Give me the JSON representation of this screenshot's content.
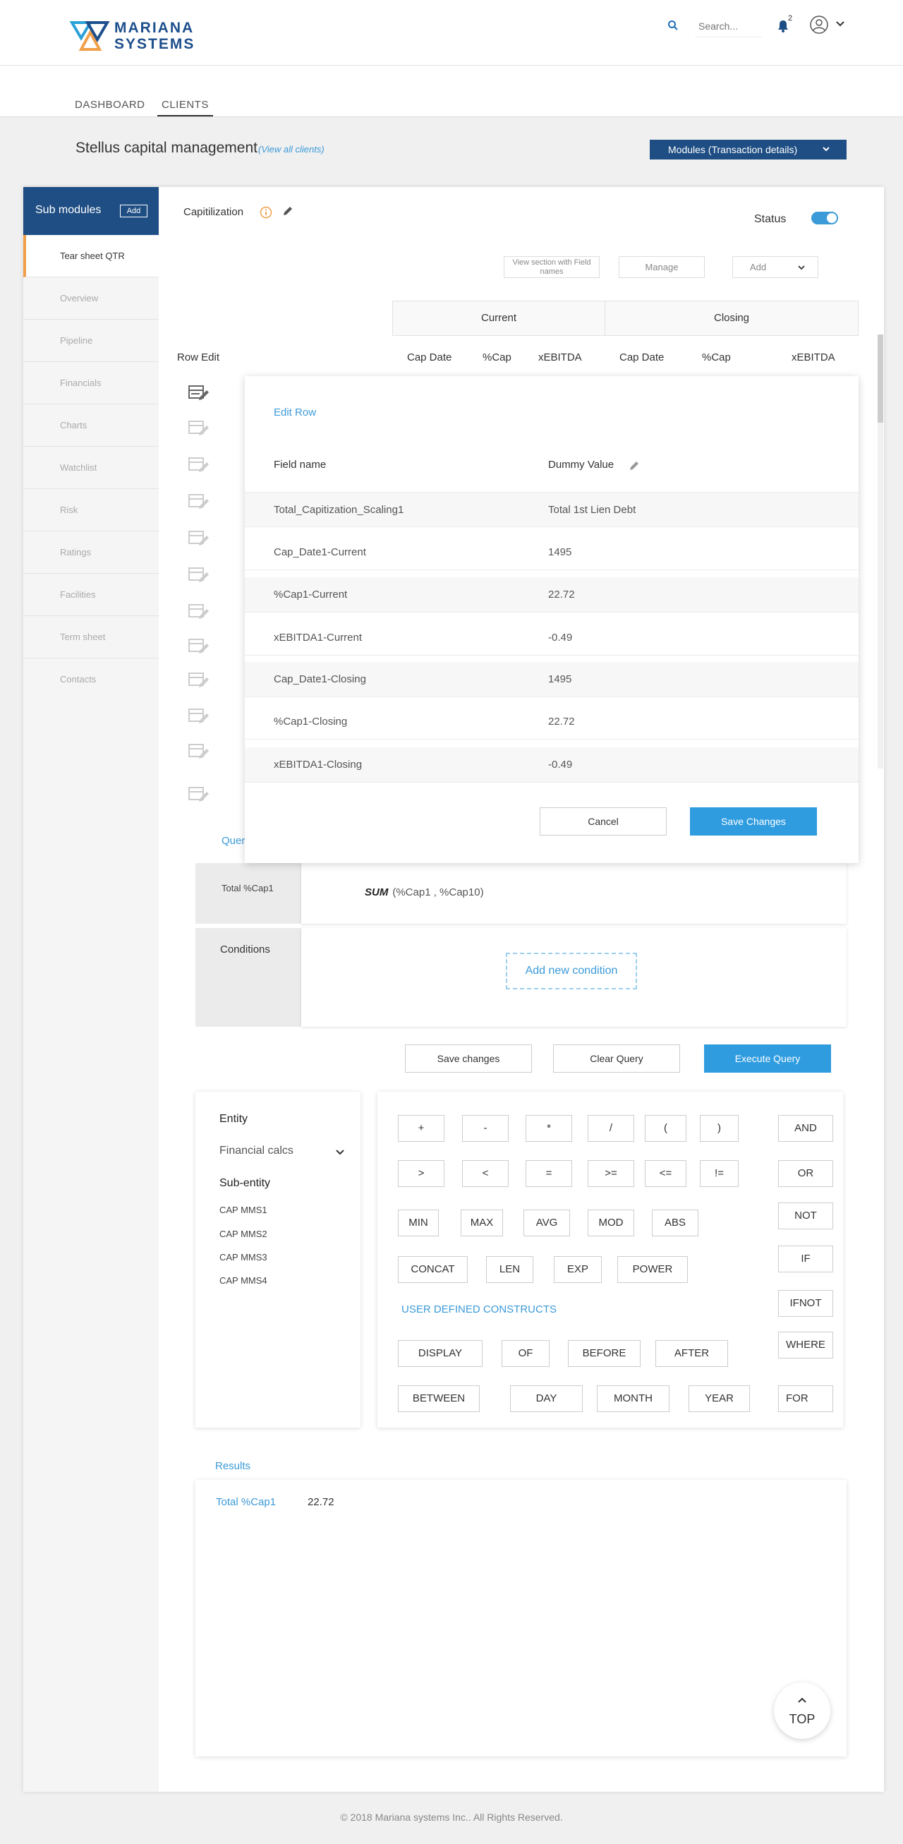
{
  "header": {
    "logo_line1": "MARIANA",
    "logo_line2": "SYSTEMS",
    "search_placeholder": "Search...",
    "notification_count": "2"
  },
  "nav": {
    "tabs": [
      {
        "label": "DASHBOARD"
      },
      {
        "label": "CLIENTS"
      }
    ],
    "active_index": 1
  },
  "page": {
    "title": "Stellus capital management",
    "view_all": "(View all clients)",
    "modules_button": "Modules  (Transaction details)"
  },
  "sidebar": {
    "title": "Sub modules",
    "add_label": "Add",
    "items": [
      {
        "label": "Tear sheet QTR"
      },
      {
        "label": "Overview"
      },
      {
        "label": "Pipeline"
      },
      {
        "label": "Financials"
      },
      {
        "label": "Charts"
      },
      {
        "label": "Watchlist"
      },
      {
        "label": "Risk"
      },
      {
        "label": "Ratings"
      },
      {
        "label": "Facilities"
      },
      {
        "label": "Term sheet"
      },
      {
        "label": "Contacts"
      }
    ]
  },
  "section": {
    "title": "Capitilization",
    "status_label": "Status",
    "status_on": true,
    "view_fields_btn": "View section with Field names",
    "manage_btn": "Manage",
    "add_btn": "Add",
    "group_current": "Current",
    "group_closing": "Closing",
    "row_edit": "Row Edit",
    "columns": [
      "Cap Date",
      "%Cap",
      "xEBITDA",
      "Cap Date",
      "%Cap",
      "xEBITDA"
    ]
  },
  "modal": {
    "title": "Edit Row",
    "field_header": "Field name",
    "value_header": "Dummy Value",
    "rows": [
      {
        "field": "Total_Capitization_Scaling1",
        "value": "Total 1st Lien Debt"
      },
      {
        "field": "Cap_Date1-Current",
        "value": "1495"
      },
      {
        "field": "%Cap1-Current",
        "value": "22.72"
      },
      {
        "field": "xEBITDA1-Current",
        "value": "-0.49"
      },
      {
        "field": "Cap_Date1-Closing",
        "value": "1495"
      },
      {
        "field": "%Cap1-Closing",
        "value": "22.72"
      },
      {
        "field": "xEBITDA1-Closing",
        "value": "-0.49"
      }
    ],
    "cancel": "Cancel",
    "save": "Save Changes"
  },
  "query": {
    "label": "Quer",
    "name": "Total %Cap1",
    "fn": "SUM",
    "args": "(%Cap1 , %Cap10)",
    "conditions_label": "Conditions",
    "add_condition": "Add new condition",
    "save_changes": "Save changes",
    "clear_query": "Clear Query",
    "execute_query": "Execute Query"
  },
  "entity": {
    "entity_label": "Entity",
    "selected": "Financial calcs",
    "sub_entity_label": "Sub-entity",
    "items": [
      "CAP MMS1",
      "CAP MMS2",
      "CAP MMS3",
      "CAP MMS4"
    ]
  },
  "operators": {
    "row1": [
      "+",
      "-",
      "*",
      "/",
      "(",
      ")"
    ],
    "row2": [
      ">",
      "<",
      "=",
      ">=",
      "<=",
      "!="
    ],
    "row3": [
      "MIN",
      "MAX",
      "AVG",
      "MOD",
      "ABS"
    ],
    "row4": [
      "CONCAT",
      "LEN",
      "EXP",
      "POWER"
    ],
    "user_defined_label": "USER DEFINED CONSTRUCTS",
    "row5": [
      "DISPLAY",
      "OF",
      "BEFORE",
      "AFTER"
    ],
    "row6": [
      "BETWEEN",
      "DAY",
      "MONTH",
      "YEAR"
    ],
    "logical": [
      "AND",
      "OR",
      "NOT",
      "IF",
      "IFNOT",
      "WHERE",
      "FOR"
    ]
  },
  "results": {
    "label": "Results",
    "name": "Total %Cap1",
    "value": "22.72",
    "top_label": "TOP"
  },
  "footer": {
    "text": "© 2018 Mariana systems Inc.. All Rights Reserved."
  },
  "colors": {
    "brand": "#1f4e84",
    "accent": "#2f9ce0",
    "highlight": "#f0a04b"
  }
}
